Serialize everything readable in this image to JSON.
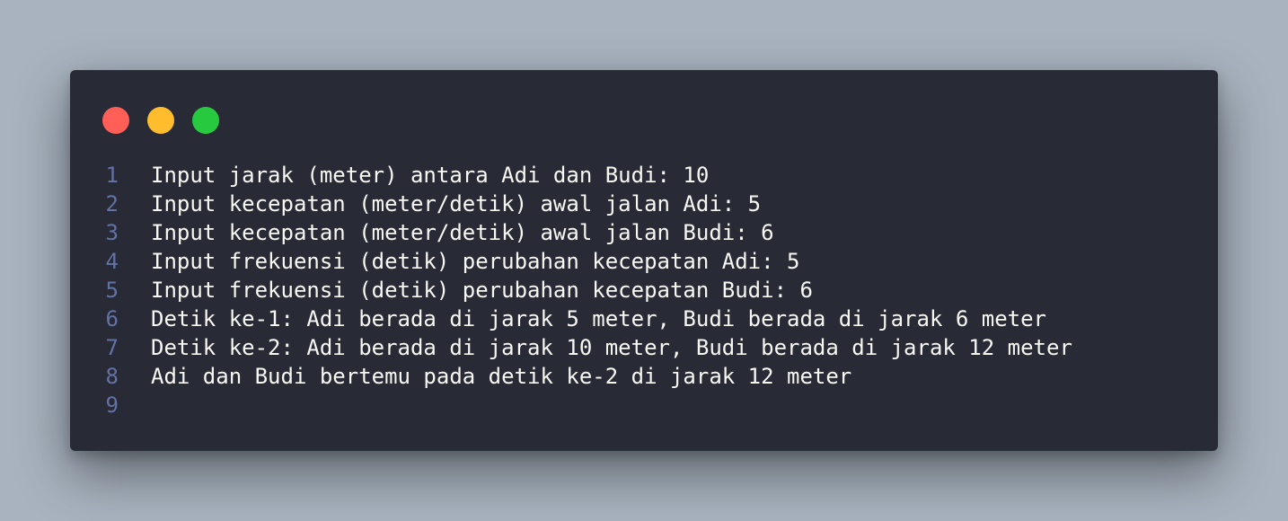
{
  "window": {
    "controls": [
      {
        "name": "close",
        "color": "#ff5f56"
      },
      {
        "name": "minimize",
        "color": "#ffbd2e"
      },
      {
        "name": "maximize",
        "color": "#27c93f"
      }
    ]
  },
  "code": {
    "lines": [
      {
        "number": "1",
        "text": "Input jarak (meter) antara Adi dan Budi: 10"
      },
      {
        "number": "2",
        "text": "Input kecepatan (meter/detik) awal jalan Adi: 5"
      },
      {
        "number": "3",
        "text": "Input kecepatan (meter/detik) awal jalan Budi: 6"
      },
      {
        "number": "4",
        "text": "Input frekuensi (detik) perubahan kecepatan Adi: 5"
      },
      {
        "number": "5",
        "text": "Input frekuensi (detik) perubahan kecepatan Budi: 6"
      },
      {
        "number": "6",
        "text": "Detik ke-1: Adi berada di jarak 5 meter, Budi berada di jarak 6 meter"
      },
      {
        "number": "7",
        "text": "Detik ke-2: Adi berada di jarak 10 meter, Budi berada di jarak 12 meter"
      },
      {
        "number": "8",
        "text": "Adi dan Budi bertemu pada detik ke-2 di jarak 12 meter"
      },
      {
        "number": "9",
        "text": ""
      }
    ]
  }
}
